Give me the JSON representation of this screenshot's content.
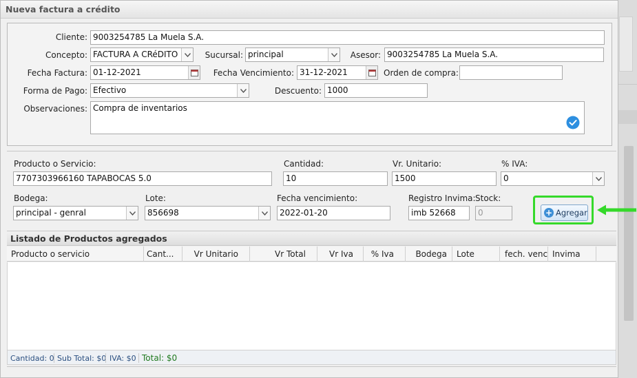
{
  "title": "Nueva factura a crédito",
  "form": {
    "cliente_label": "Cliente:",
    "cliente_value": "9003254785 La Muela S.A.",
    "concepto_label": "Concepto:",
    "concepto_value": "FACTURA A CRéDITO",
    "sucursal_label": "Sucursal:",
    "sucursal_value": "principal",
    "asesor_label": "Asesor:",
    "asesor_value": "9003254785 La Muela S.A.",
    "fecha_factura_label": "Fecha Factura:",
    "fecha_factura_value": "01-12-2021",
    "fecha_vencimiento_label": "Fecha Vencimiento:",
    "fecha_vencimiento_value": "31-12-2021",
    "orden_compra_label": "Orden de compra:",
    "orden_compra_value": "",
    "forma_pago_label": "Forma de Pago:",
    "forma_pago_value": "Efectivo",
    "descuento_label": "Descuento:",
    "descuento_value": "1000",
    "observaciones_label": "Observaciones:",
    "observaciones_value": "Compra de inventarios"
  },
  "product": {
    "producto_label": "Producto o Servicio:",
    "producto_value": "7707303966160 TAPABOCAS 5.0",
    "cantidad_label": "Cantidad:",
    "cantidad_value": "10",
    "vr_unitario_label": "Vr. Unitario:",
    "vr_unitario_value": "1500",
    "iva_label": "% IVA:",
    "iva_value": "0",
    "bodega_label": "Bodega:",
    "bodega_value": "principal - genral",
    "lote_label": "Lote:",
    "lote_value": "856698",
    "fecha_venc_label": "Fecha vencimiento:",
    "fecha_venc_value": "2022-01-20",
    "registro_label": "Registro Invima:",
    "registro_value": "imb 52668",
    "stock_label": "Stock:",
    "stock_value": "0",
    "agregar_label": "Agregar"
  },
  "list": {
    "title": "Listado de Productos agregados",
    "columns": [
      "Producto o servicio",
      "Cant...",
      "Vr Unitario",
      "Vr Total",
      "Vr Iva",
      "% Iva",
      "Bodega",
      "Lote",
      "fech. venc.",
      "Invima"
    ],
    "footer": {
      "cantidad": "Cantidad: 0",
      "subtotal": "Sub Total: $0",
      "iva": "IVA: $0",
      "total": "Total: $0"
    }
  },
  "colors": {
    "highlight": "#35d92a",
    "button_icon": "#3d8fd6",
    "check_icon": "#2d8fe0",
    "total_text": "#207a20"
  }
}
